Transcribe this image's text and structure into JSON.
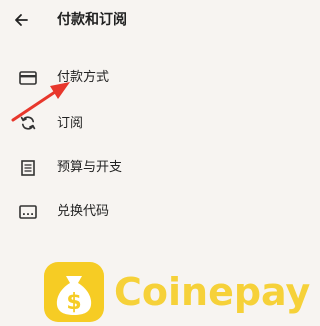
{
  "header": {
    "title": "付款和订阅",
    "back_icon": "arrow-left-icon"
  },
  "menu": [
    {
      "label": "付款方式",
      "icon": "credit-card-icon"
    },
    {
      "label": "订阅",
      "icon": "refresh-icon"
    },
    {
      "label": "预算与开支",
      "icon": "receipt-icon"
    },
    {
      "label": "兑换代码",
      "icon": "redeem-code-icon"
    }
  ],
  "annotation": {
    "color": "#e8372c"
  },
  "watermark": {
    "text": "Coinepay",
    "color": "#f6cf2a"
  }
}
